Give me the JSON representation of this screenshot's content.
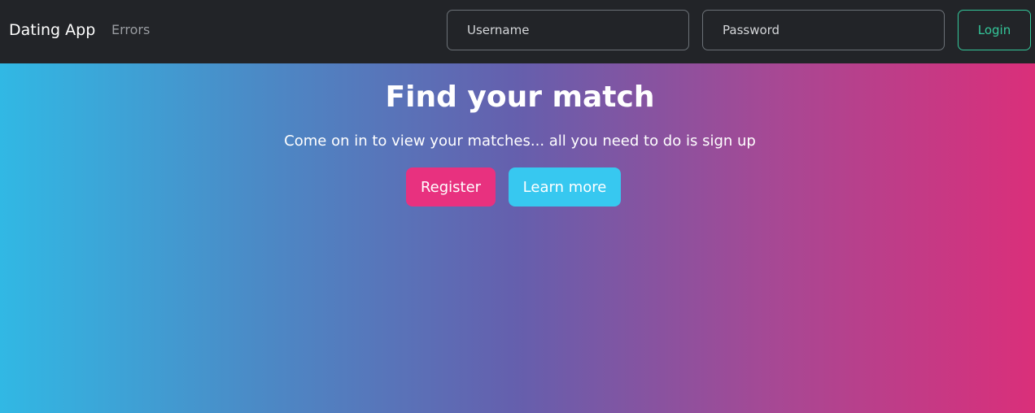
{
  "navbar": {
    "brand": "Dating App",
    "links": [
      {
        "label": "Errors"
      }
    ],
    "username": {
      "placeholder": "Username",
      "value": ""
    },
    "password": {
      "placeholder": "Password",
      "value": ""
    },
    "login_label": "Login"
  },
  "hero": {
    "title": "Find your match",
    "subtitle": "Come on in to view your matches... all you need to do is sign up",
    "register_label": "Register",
    "learn_more_label": "Learn more"
  },
  "colors": {
    "navbar_bg": "#222428",
    "login_accent": "#34c79a",
    "register_bg": "#e8317f",
    "learn_more_bg": "#37c8f0",
    "gradient_start": "#31b8e4",
    "gradient_end": "#da2f7a"
  }
}
